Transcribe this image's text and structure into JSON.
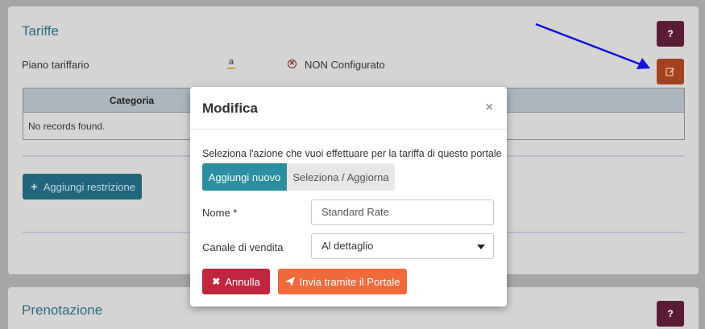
{
  "tariffe": {
    "title": "Tariffe",
    "help_label": "?",
    "piano_label": "Piano tariffario",
    "status_text": "NON Configurato",
    "table": {
      "col_category": "Categoria",
      "empty_text": "No records found."
    },
    "add_restriction_label": "Aggiungi restrizione"
  },
  "prenotazione": {
    "title": "Prenotazione",
    "help_label": "?"
  },
  "modal": {
    "title": "Modifica",
    "close_label": "×",
    "description": "Seleziona l'azione che vuoi effettuare per la tariffa di questo portale",
    "tab_new": "Aggiungi nuovo",
    "tab_update": "Seleziona / Aggiorna",
    "name_label": "Nome *",
    "name_placeholder": "Standard Rate",
    "channel_label": "Canale di vendita",
    "channel_value": "Al dettaglio",
    "cancel_label": "Annulla",
    "submit_label": "Invia tramite il Portale"
  },
  "colors": {
    "accent": "#2b8fa1",
    "danger": "#c0273e",
    "submit": "#f06a3b",
    "arrow": "#1010e0"
  }
}
